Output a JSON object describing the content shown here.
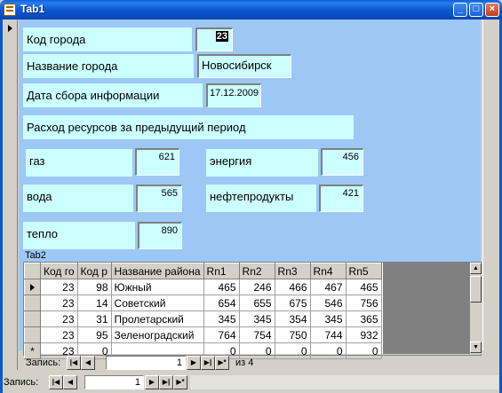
{
  "window": {
    "title": "Tab1"
  },
  "form": {
    "city_code_label": "Код города",
    "city_code_value": "23",
    "city_name_label": "Название города",
    "city_name_value": "Новосибирск",
    "date_label": "Дата сбора информации",
    "date_value": "17.12.2009",
    "prev_period_label": "Расход ресурсов за предыдущий период",
    "gas_label": "газ",
    "gas_value": "621",
    "energy_label": "энергия",
    "energy_value": "456",
    "water_label": "вода",
    "water_value": "565",
    "oil_label": "нефтепродукты",
    "oil_value": "421",
    "heat_label": "тепло",
    "heat_value": "890"
  },
  "subform": {
    "caption": "Tab2",
    "columns": [
      "Код го",
      "Код р",
      "Название района",
      "Rn1",
      "Rn2",
      "Rn3",
      "Rn4",
      "Rn5"
    ],
    "rows": [
      [
        "23",
        "98",
        "Южный",
        "465",
        "246",
        "466",
        "467",
        "465"
      ],
      [
        "23",
        "14",
        "Советский",
        "654",
        "655",
        "675",
        "546",
        "756"
      ],
      [
        "23",
        "31",
        "Пролетарский",
        "345",
        "345",
        "354",
        "345",
        "365"
      ],
      [
        "23",
        "95",
        "Зеленоградский",
        "764",
        "754",
        "750",
        "744",
        "932"
      ]
    ],
    "new_row": [
      "23",
      "0",
      "",
      "0",
      "0",
      "0",
      "0",
      "0"
    ],
    "nav": {
      "label": "Запись:",
      "current": "1",
      "of_text": "из  4"
    }
  },
  "main_nav": {
    "label": "Запись:",
    "current": "1"
  },
  "icons": {
    "first": "first-record-icon",
    "prev": "prev-record-icon",
    "next": "next-record-icon",
    "last": "last-record-icon",
    "new": "new-record-icon"
  }
}
